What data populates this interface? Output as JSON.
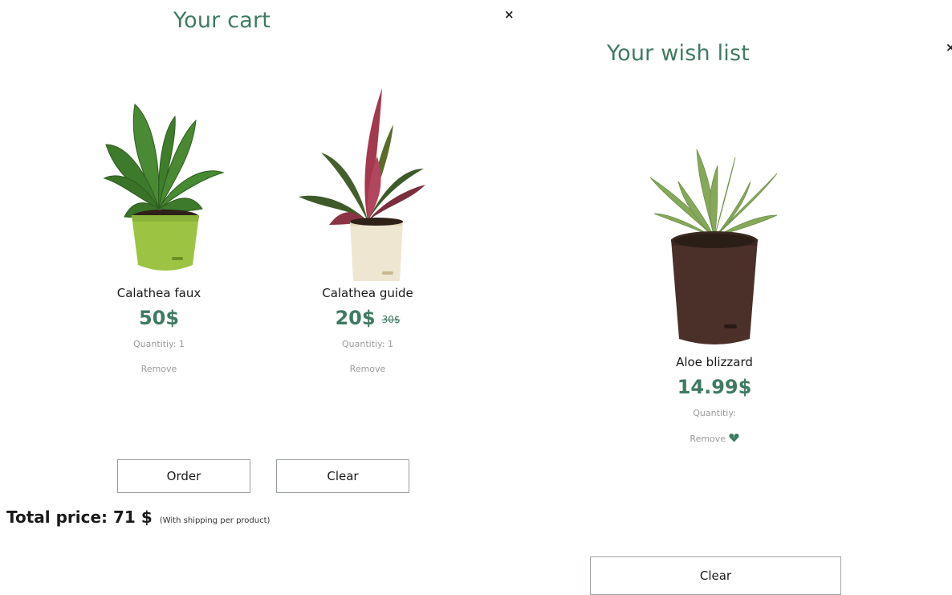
{
  "cart": {
    "title": "Your cart",
    "close_symbol": "×",
    "items": [
      {
        "name": "Calathea faux",
        "price": "50$",
        "old_price": "",
        "quantity": "Quantitiy: 1",
        "remove_label": "Remove"
      },
      {
        "name": "Calathea guide",
        "price": "20$",
        "old_price": "30$",
        "quantity": "Quantitiy: 1",
        "remove_label": "Remove"
      }
    ],
    "order_label": "Order",
    "clear_label": "Clear",
    "total_text": "Total price: 71 $",
    "total_note": "(With shipping per product)"
  },
  "wishlist": {
    "title": "Your wish list",
    "close_symbol": "×",
    "items": [
      {
        "name": "Aloe blizzard",
        "price": "14.99$",
        "quantity": "Quantitiy:",
        "remove_label": "Remove",
        "remove_icon": "broken-heart-icon"
      }
    ],
    "clear_label": "Clear"
  },
  "colors": {
    "accent_green": "#3f7a62",
    "muted_text": "#9a9a9a",
    "button_border": "#9aa0a0"
  }
}
